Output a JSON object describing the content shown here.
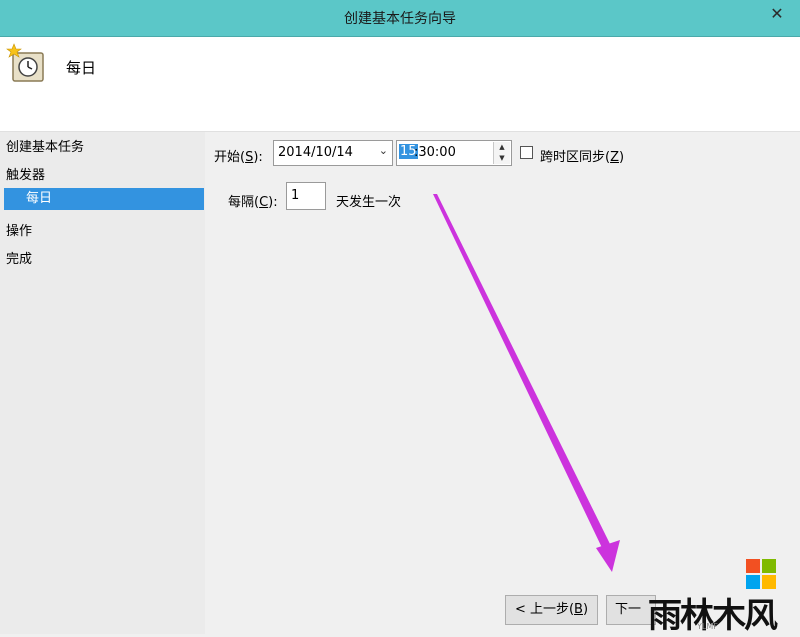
{
  "window": {
    "title": "创建基本任务向导",
    "close_glyph": "✕"
  },
  "header": {
    "page_title": "每日",
    "icon": "scheduled-task-clock-icon"
  },
  "sidebar": {
    "items": [
      {
        "label": "创建基本任务"
      },
      {
        "label": "触发器"
      },
      {
        "label": "每日",
        "selected": true
      },
      {
        "label": "操作"
      },
      {
        "label": "完成"
      }
    ]
  },
  "form": {
    "start_label": "开始(",
    "start_key": "S",
    "start_label_end": "):",
    "date_value": "2014/10/14",
    "time_hour_selected": "15",
    "time_rest": ":30:00",
    "sync_label": "跨时区同步(",
    "sync_key": "Z",
    "sync_label_end": ")",
    "sync_checked": false,
    "recur_label": "每隔(",
    "recur_key": "C",
    "recur_label_end": "):",
    "recur_value": "1",
    "recur_suffix": "天发生一次"
  },
  "buttons": {
    "back_label": "< 上一步(",
    "back_key": "B",
    "back_end": ")",
    "next_label": "下一"
  },
  "watermark": {
    "text": "雨林木风",
    "subtext": "YLMF"
  },
  "colors": {
    "titlebar": "#5bc7c8",
    "selection": "#3393e0",
    "annotation_arrow": "#cc33dd"
  }
}
